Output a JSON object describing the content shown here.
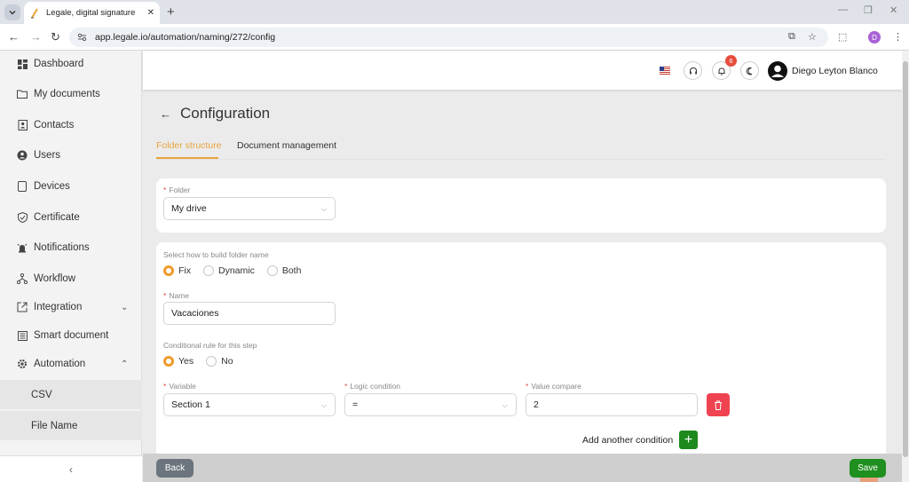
{
  "browser": {
    "tab_title": "Legale, digital signature",
    "tab_close": "✕",
    "new_tab": "+",
    "url": "app.legale.io/automation/naming/272/config",
    "profile_initial": "D",
    "window_controls": {
      "minimize": "—",
      "restore": "❐",
      "close": "✕"
    }
  },
  "sidebar": {
    "items": [
      {
        "label": "Dashboard",
        "icon": "dashboard-icon"
      },
      {
        "label": "My documents",
        "icon": "folder-icon"
      },
      {
        "label": "Contacts",
        "icon": "contacts-icon"
      },
      {
        "label": "Users",
        "icon": "user-icon"
      },
      {
        "label": "Devices",
        "icon": "device-icon"
      },
      {
        "label": "Certificate",
        "icon": "shield-check-icon"
      },
      {
        "label": "Notifications",
        "icon": "alarm-icon"
      },
      {
        "label": "Workflow",
        "icon": "workflow-icon"
      },
      {
        "label": "Integration",
        "icon": "external-link-icon"
      },
      {
        "label": "Smart document",
        "icon": "smart-document-icon"
      },
      {
        "label": "Automation",
        "icon": "gear-icon"
      }
    ],
    "sub_items": [
      "CSV",
      "File Name"
    ],
    "collapse_glyph": "‹"
  },
  "header": {
    "notification_count": "6",
    "user_name": "Diego Leyton Blanco"
  },
  "page": {
    "back_glyph": "←",
    "title": "Configuration",
    "tabs": [
      {
        "label": "Folder structure",
        "active": true
      },
      {
        "label": "Document management",
        "active": false
      }
    ]
  },
  "folder_card": {
    "label": "Folder",
    "value": "My drive"
  },
  "name_card": {
    "build_label": "Select how to build folder name",
    "build_options": [
      "Fix",
      "Dynamic",
      "Both"
    ],
    "build_selected": "Fix",
    "name_label": "Name",
    "name_value": "Vacaciones",
    "cond_label": "Conditional rule for this step",
    "cond_options": [
      "Yes",
      "No"
    ],
    "cond_selected": "Yes",
    "variable_label": "Variable",
    "variable_value": "Section 1",
    "logic_label": "Logic condition",
    "logic_value": "=",
    "compare_label": "Value compare",
    "compare_value": "2",
    "add_condition_label": "Add another condition",
    "add_glyph": "+"
  },
  "footer": {
    "back_label": "Back",
    "save_label": "Save"
  },
  "colors": {
    "accent": "#e8a33d",
    "danger": "#f04351",
    "success": "#1f8f1f",
    "secondary": "#6c757d"
  }
}
